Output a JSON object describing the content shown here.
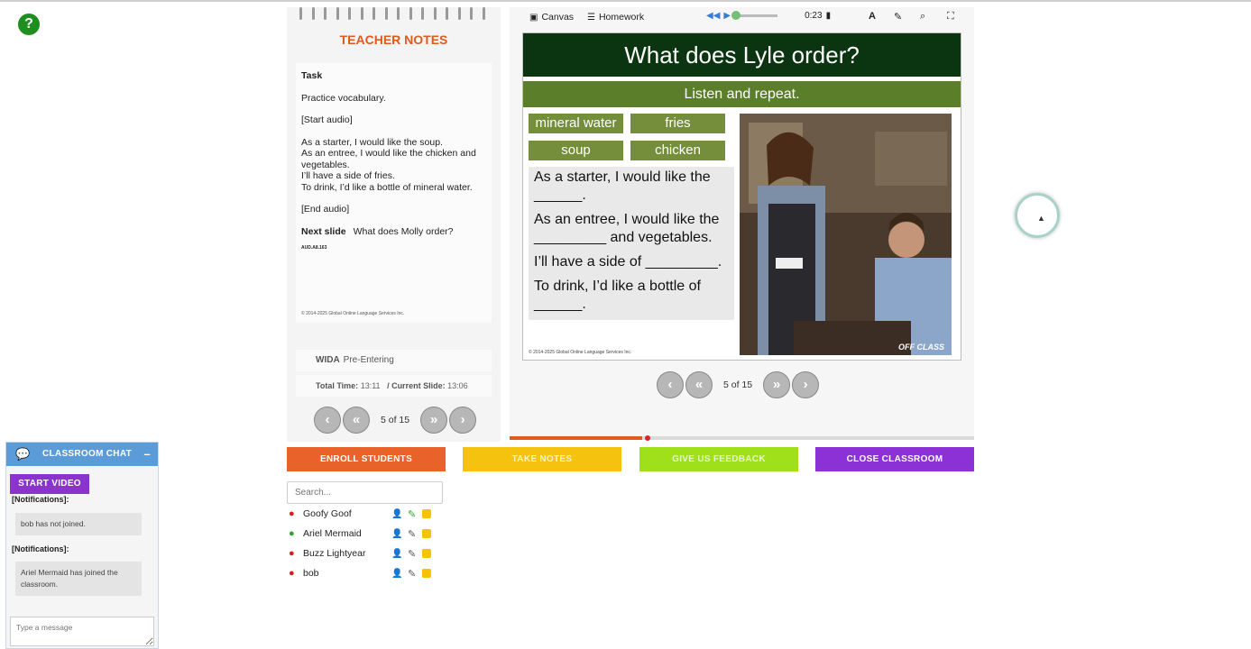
{
  "help": {
    "label": "?"
  },
  "notes": {
    "title": "TEACHER NOTES",
    "task_label": "Task",
    "lines": [
      "Practice vocabulary.",
      "[Start audio]"
    ],
    "script": [
      "As a starter, I would like the soup.",
      "As an entree, I would like the chicken and vegetables.",
      "I’ll have a side of fries.",
      "To drink, I’d like a bottle of mineral water."
    ],
    "end_audio": "[End audio]",
    "next_label": "Next slide",
    "next_value": "What does Molly order?",
    "code": "AUD.A8.163",
    "copyright": "© 2014-2025 Global Online Language Services Inc.",
    "wida_label": "WIDA",
    "wida_value": "Pre-Entering",
    "total_label": "Total Time:",
    "total_value": "13:11",
    "current_label": "/ Current Slide:",
    "current_value": "13:06",
    "page": "5 of 15"
  },
  "toolbar": {
    "canvas": "Canvas",
    "homework": "Homework",
    "audio_time": "0:23",
    "font_icon": "A"
  },
  "slide": {
    "title": "What does Lyle order?",
    "subtitle": "Listen and repeat.",
    "words": [
      "mineral water",
      "fries",
      "soup",
      "chicken"
    ],
    "sentences": [
      "As a starter, I would like the ______.",
      "As an entree, I would like the _________ and vegetables.",
      "I’ll have a side of _________.",
      "To drink, I’d like a bottle of ______."
    ],
    "copyright": "© 2014-2025 Global Online Language Services Inc.",
    "logo": "OFF CLASS",
    "page": "5 of 15",
    "progress_fraction": 0.29
  },
  "buttons": {
    "enroll": "ENROLL STUDENTS",
    "notes": "TAKE NOTES",
    "feedback": "GIVE US FEEDBACK",
    "close": "CLOSE CLASSROOM"
  },
  "colors": {
    "enroll": "#e8622a",
    "notes": "#f5c20f",
    "feedback": "#9fe01a",
    "close": "#8c31d6"
  },
  "search": {
    "placeholder": "Search..."
  },
  "students": [
    {
      "name": "Goofy Goof",
      "status": "absent"
    },
    {
      "name": "Ariel Mermaid",
      "status": "joined"
    },
    {
      "name": "Buzz Lightyear",
      "status": "absent"
    },
    {
      "name": "bob",
      "status": "absent"
    }
  ],
  "chat": {
    "title": "CLASSROOM CHAT",
    "video_button": "START VIDEO",
    "partial_label": "[Notifications]:",
    "msg1": "bob has not joined.",
    "label2": "[Notifications]:",
    "msg2": "Ariel Mermaid has joined the classroom.",
    "input_placeholder": "Type a message"
  }
}
